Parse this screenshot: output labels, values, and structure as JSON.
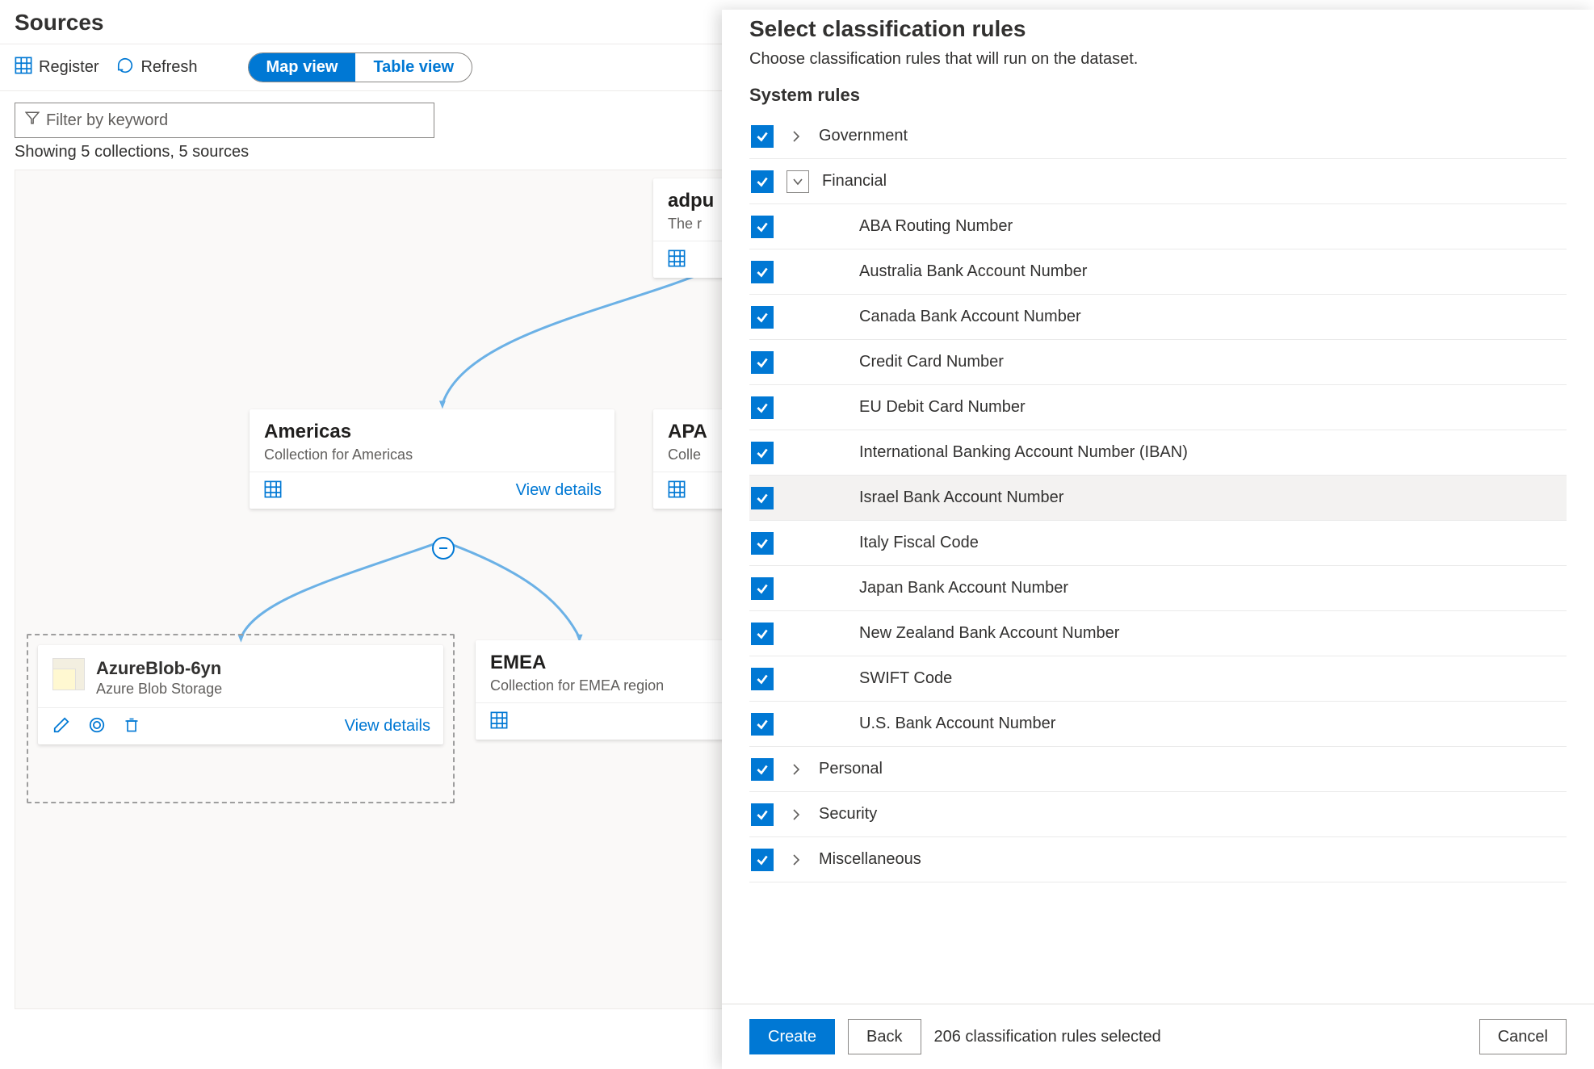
{
  "header": {
    "title": "Sources"
  },
  "toolbar": {
    "register": "Register",
    "refresh": "Refresh",
    "map_view": "Map view",
    "table_view": "Table view"
  },
  "filter": {
    "placeholder": "Filter by keyword"
  },
  "summary": "Showing 5 collections, 5 sources",
  "map": {
    "root": {
      "title": "adpu",
      "subtitle": "The r"
    },
    "americas": {
      "title": "Americas",
      "subtitle": "Collection for Americas",
      "view_details": "View details"
    },
    "apac": {
      "title": "APA",
      "subtitle": "Colle"
    },
    "emea": {
      "title": "EMEA",
      "subtitle": "Collection for EMEA region"
    },
    "source": {
      "title": "AzureBlob-6yn",
      "subtitle": "Azure Blob Storage",
      "view_details": "View details"
    }
  },
  "panel": {
    "title": "Select classification rules",
    "description": "Choose classification rules that will run on the dataset.",
    "section_label": "System rules",
    "categories": {
      "government": "Government",
      "financial": "Financial",
      "personal": "Personal",
      "security": "Security",
      "misc": "Miscellaneous"
    },
    "financial_rules": [
      "ABA Routing Number",
      "Australia Bank Account Number",
      "Canada Bank Account Number",
      "Credit Card Number",
      "EU Debit Card Number",
      "International Banking Account Number (IBAN)",
      "Israel Bank Account Number",
      "Italy Fiscal Code",
      "Japan Bank Account Number",
      "New Zealand Bank Account Number",
      "SWIFT Code",
      "U.S. Bank Account Number"
    ],
    "footer": {
      "create": "Create",
      "back": "Back",
      "status": "206 classification rules selected",
      "cancel": "Cancel"
    }
  }
}
